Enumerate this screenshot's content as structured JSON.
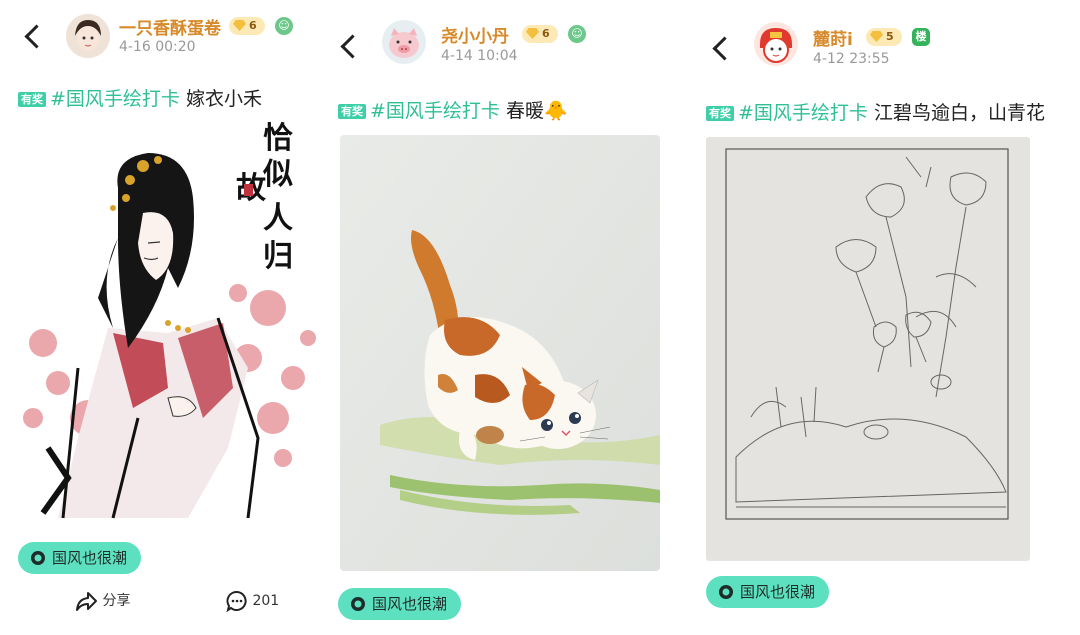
{
  "posts": [
    {
      "username": "一只香酥蛋卷",
      "level": "6",
      "timestamp": "4-16 00:20",
      "prize_label": "有奖",
      "hashtag": "#国风手绘打卡",
      "caption": "嫁衣小禾",
      "art_calligraphy": "恰似故人归",
      "topic": "国风也很潮",
      "share_label": "分享",
      "comment_count": "201",
      "avatar_icon": "girl-avatar-icon",
      "level_icon": "emoji-badge-icon"
    },
    {
      "username": "尧小小丹",
      "level": "6",
      "timestamp": "4-14 10:04",
      "prize_label": "有奖",
      "hashtag": "#国风手绘打卡",
      "caption": "春暖",
      "caption_emoji": "🐥",
      "topic": "国风也很潮",
      "avatar_icon": "pig-avatar-icon",
      "level_icon": "emoji-badge-icon"
    },
    {
      "username": "麓莳i",
      "level": "5",
      "level_badge_text": "楼",
      "timestamp": "4-12 23:55",
      "prize_label": "有奖",
      "hashtag": "#国风手绘打卡",
      "caption": "江碧鸟逾白，山青花",
      "topic": "国风也很潮",
      "avatar_icon": "tiger-avatar-icon"
    }
  ],
  "colors": {
    "accent": "#2fbf95",
    "pill_bg": "#5de0bf",
    "username": "#d88a2a"
  }
}
